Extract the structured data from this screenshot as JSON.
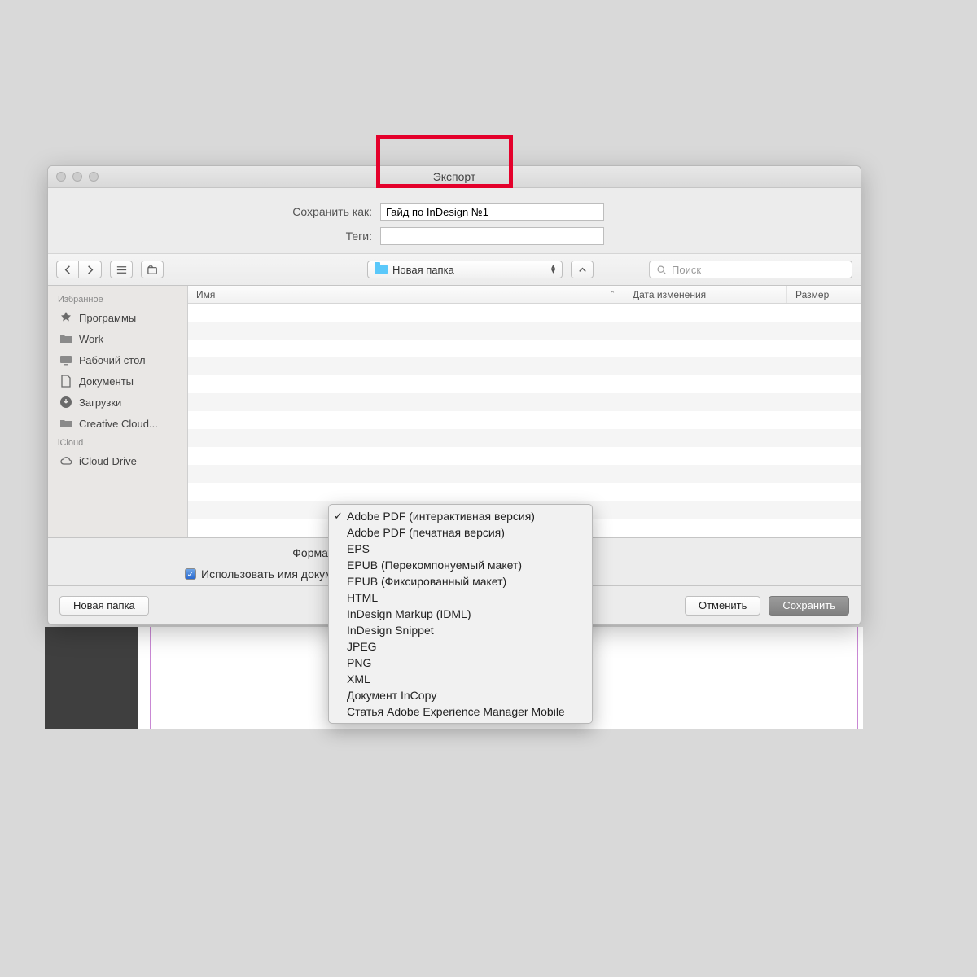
{
  "window": {
    "title": "Экспорт"
  },
  "form": {
    "save_as_label": "Сохранить как:",
    "save_as_value": "Гайд по InDesign №1",
    "tags_label": "Теги:",
    "tags_value": ""
  },
  "toolbar": {
    "location": "Новая папка",
    "search_placeholder": "Поиск"
  },
  "sidebar": {
    "favorites_header": "Избранное",
    "favorites": [
      {
        "label": "Программы",
        "icon": "apps"
      },
      {
        "label": "Work",
        "icon": "folder"
      },
      {
        "label": "Рабочий стол",
        "icon": "desktop"
      },
      {
        "label": "Документы",
        "icon": "doc"
      },
      {
        "label": "Загрузки",
        "icon": "download"
      },
      {
        "label": "Creative Cloud...",
        "icon": "folder"
      }
    ],
    "icloud_header": "iCloud",
    "icloud": [
      {
        "label": "iCloud Drive",
        "icon": "cloud"
      }
    ]
  },
  "columns": {
    "name": "Имя",
    "date": "Дата изменения",
    "size": "Размер",
    "sort_indicator": "⌃"
  },
  "format": {
    "label": "Формат",
    "checkbox_label": "Использовать имя документа",
    "checkbox_checked": true,
    "options": [
      "Adobe PDF (интерактивная версия)",
      "Adobe PDF (печатная версия)",
      "EPS",
      "EPUB (Перекомпонуемый макет)",
      "EPUB (Фиксированный макет)",
      "HTML",
      "InDesign Markup (IDML)",
      "InDesign Snippet",
      "JPEG",
      "PNG",
      "XML",
      "Документ InCopy",
      "Статья Adobe Experience Manager Mobile"
    ],
    "selected_index": 0
  },
  "buttons": {
    "new_folder": "Новая папка",
    "cancel": "Отменить",
    "save": "Сохранить"
  }
}
